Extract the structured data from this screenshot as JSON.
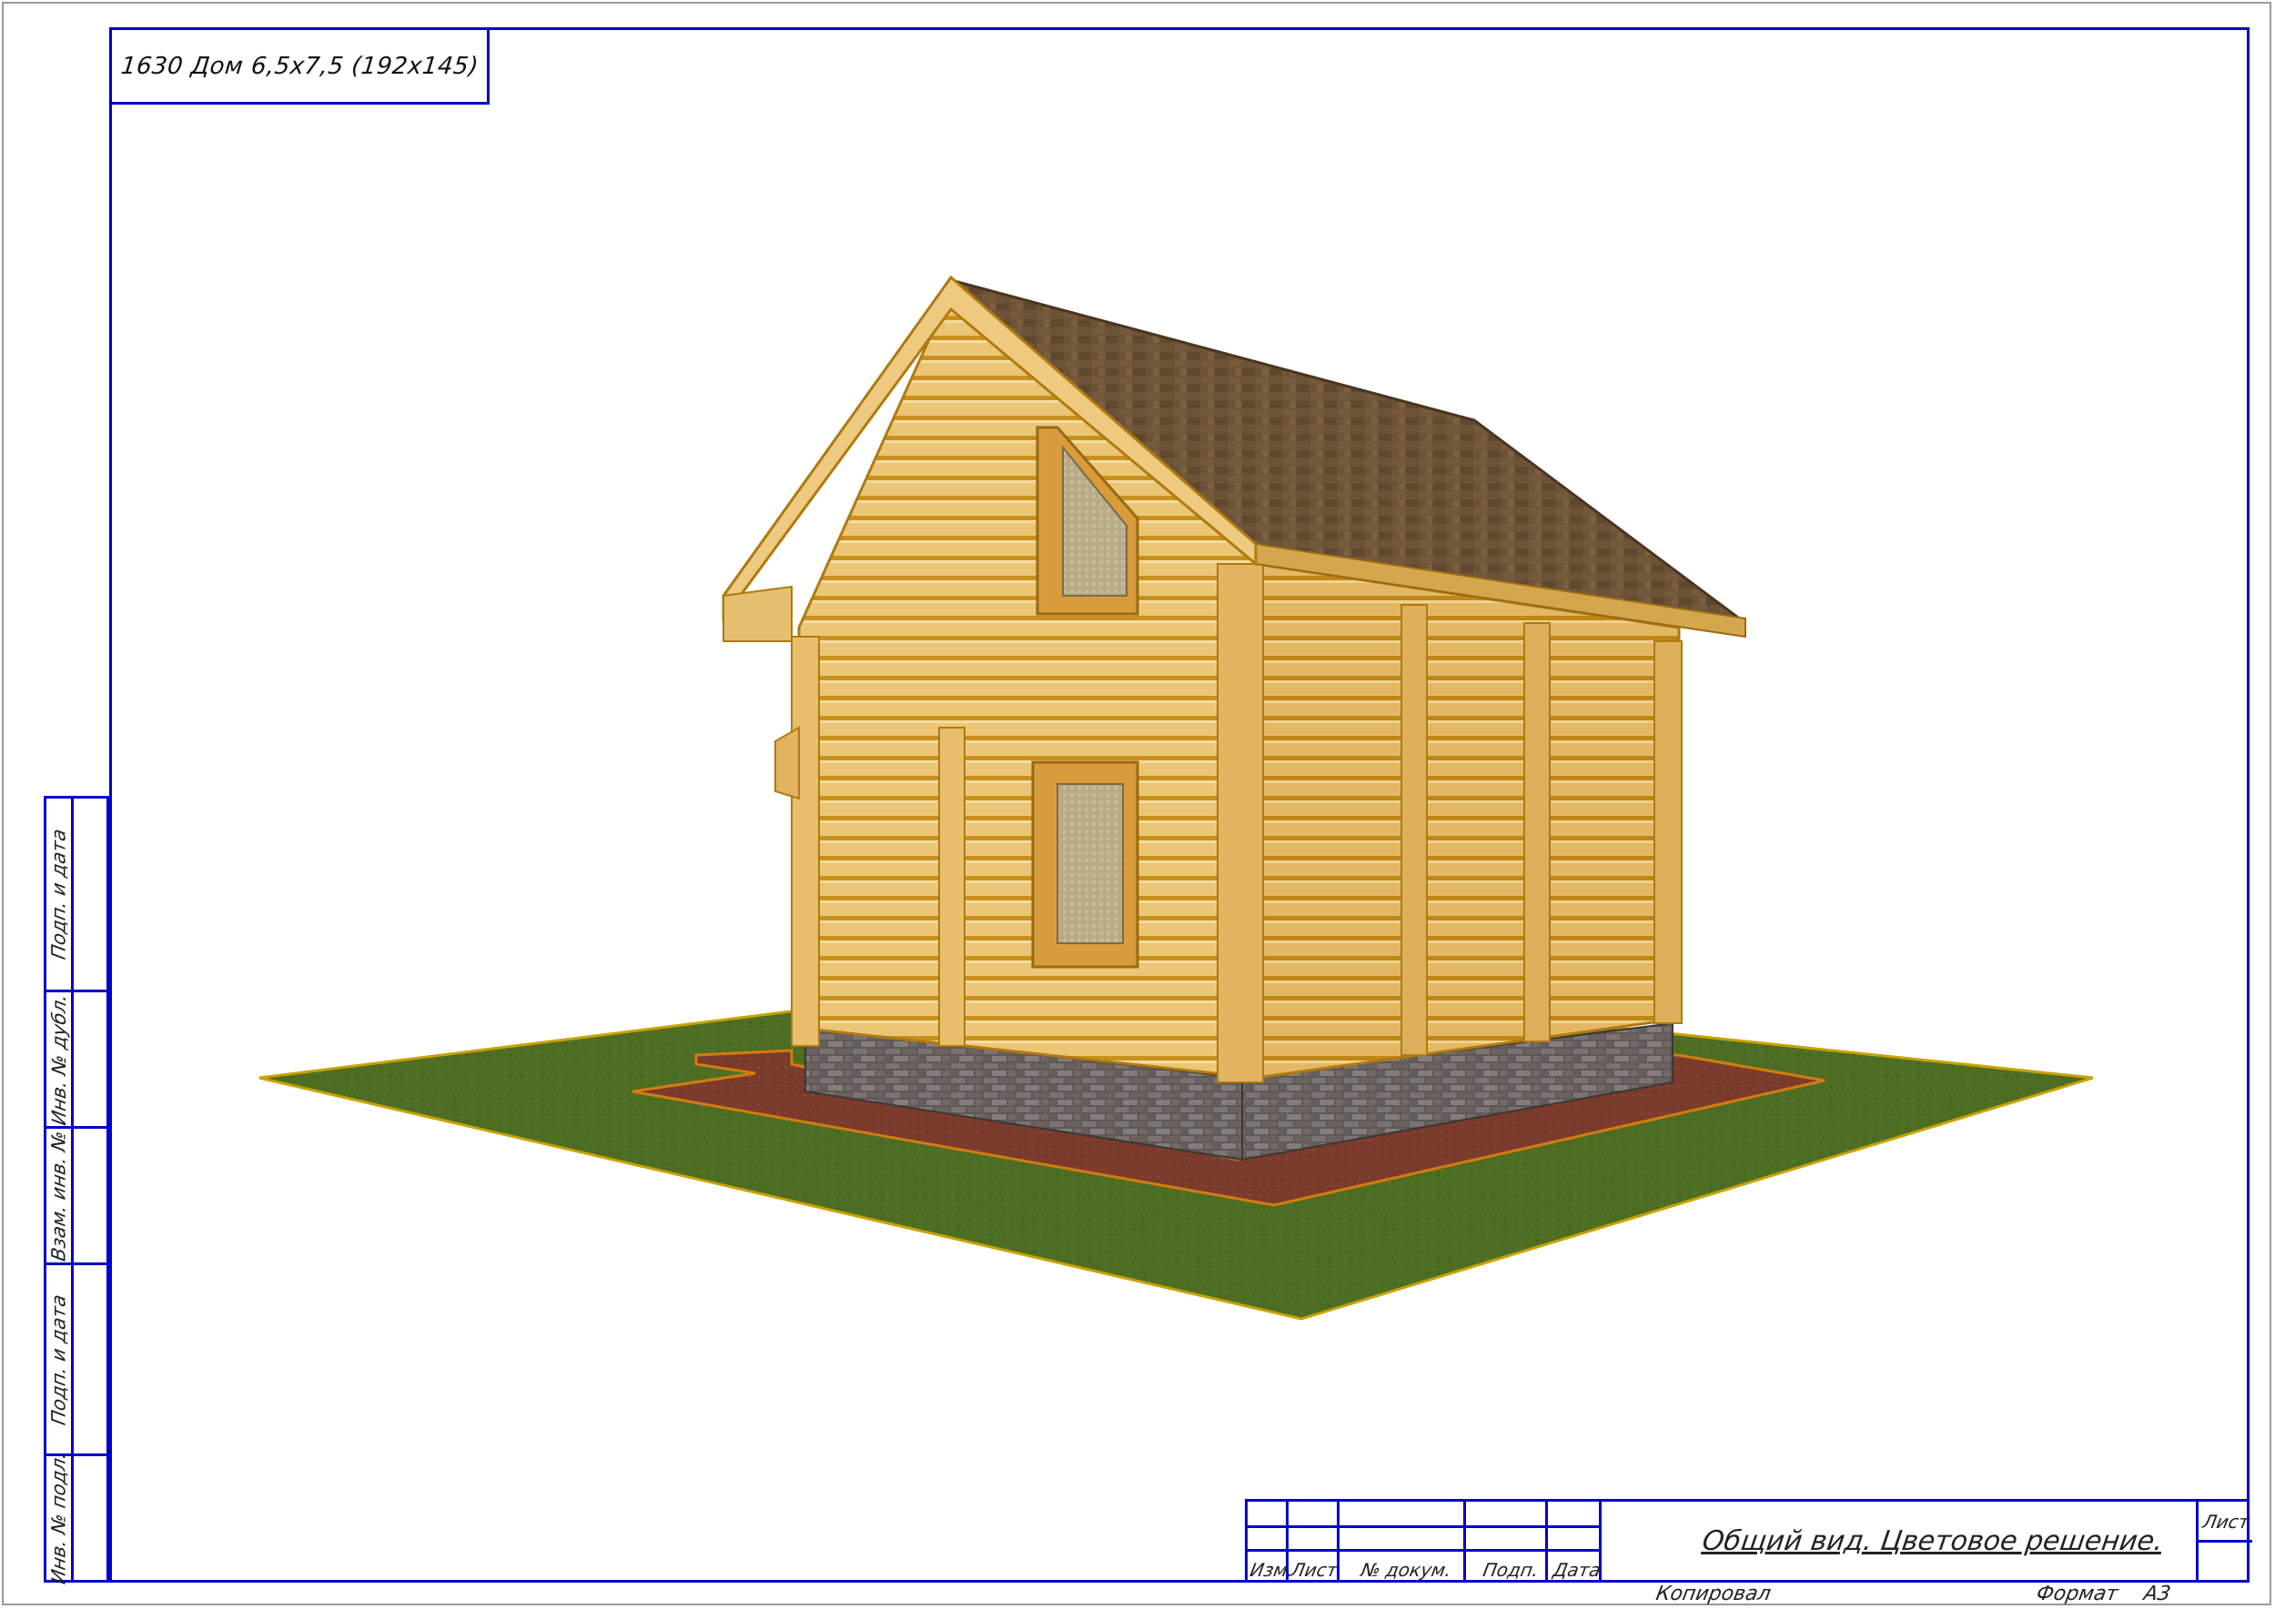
{
  "project": {
    "title": "1630 Дом 6,5х7,5 (192х145)"
  },
  "left_strip": {
    "labels": [
      "Подп. и дата",
      "Инв. № дубл.",
      "Взам. инв. №",
      "Подп. и дата",
      "Инв. № подл."
    ]
  },
  "title_block": {
    "columns": [
      "Изм.",
      "Лист",
      "№ докум.",
      "Подп.",
      "Дата"
    ],
    "sheet_title": "Общий вид. Цветовое решение.",
    "sheet_label": "Лист"
  },
  "footer": {
    "copied": "Копировал",
    "format_label": "Формат",
    "format_value": "А3"
  },
  "colors": {
    "frame": "#0000cc",
    "log_wall": "#e9c16e",
    "roof": "#6a5034",
    "lawn": "#4c6b22",
    "plinth": "#6a6462",
    "path": "#7a3a2a"
  }
}
